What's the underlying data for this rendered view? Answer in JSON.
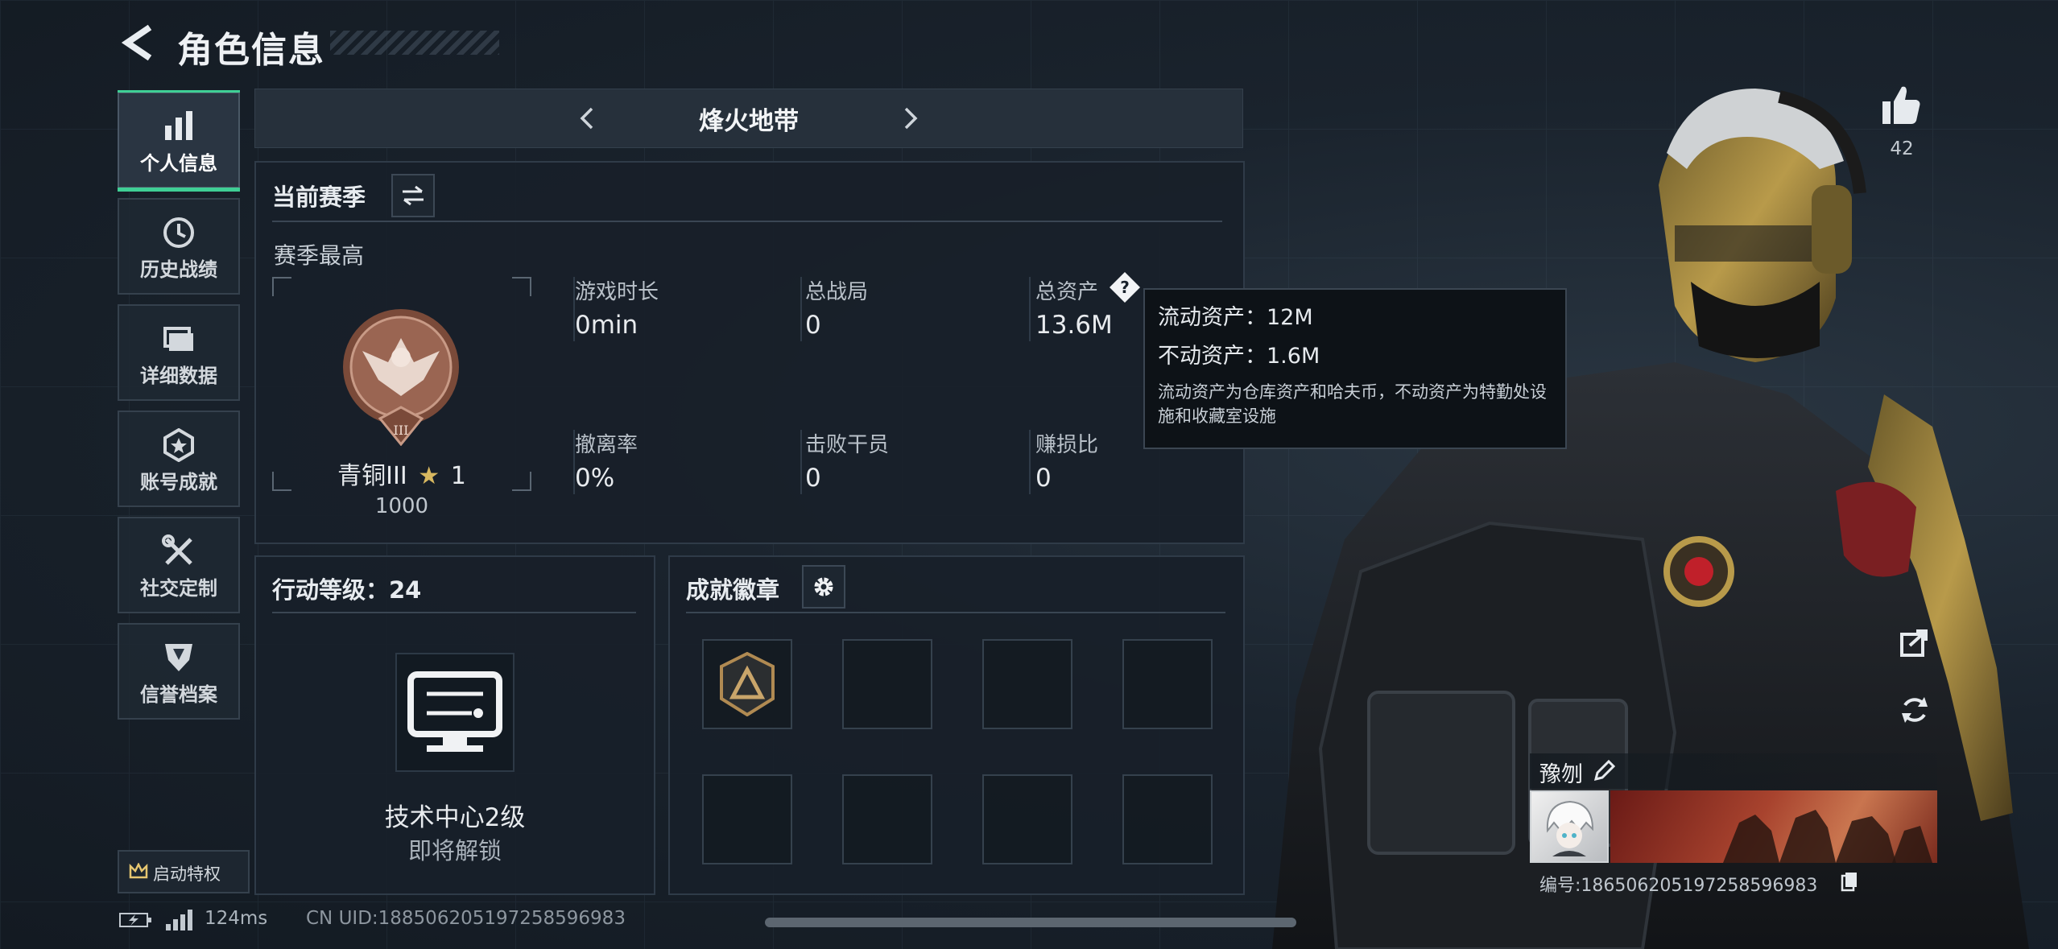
{
  "header": {
    "title": "角色信息"
  },
  "sidebar": {
    "items": [
      {
        "label": "个人信息",
        "icon": "bar-chart-icon",
        "active": true
      },
      {
        "label": "历史战绩",
        "icon": "clock-icon",
        "active": false
      },
      {
        "label": "详细数据",
        "icon": "folder-icon",
        "active": false
      },
      {
        "label": "账号成就",
        "icon": "medal-icon",
        "active": false
      },
      {
        "label": "社交定制",
        "icon": "tools-icon",
        "active": false
      },
      {
        "label": "信誉档案",
        "icon": "shield-icon",
        "active": false
      }
    ],
    "privilege_label": "启动特权"
  },
  "mode_selector": {
    "label": "烽火地带"
  },
  "season": {
    "title": "当前赛季",
    "subtitle": "赛季最高",
    "rank_name": "青铜III",
    "rank_stars": "1",
    "rank_points": "1000",
    "stats": [
      {
        "label": "游戏时长",
        "value": "0min"
      },
      {
        "label": "总战局",
        "value": "0"
      },
      {
        "label": "总资产",
        "value": "13.6M"
      },
      {
        "label": "撤离率",
        "value": "0%"
      },
      {
        "label": "击败干员",
        "value": "0"
      },
      {
        "label": "赚损比",
        "value": "0"
      }
    ]
  },
  "tooltip": {
    "line1": "流动资产：12M",
    "line2": "不动资产：1.6M",
    "desc": "流动资产为仓库资产和哈夫币，不动资产为特勤处设施和收藏室设施"
  },
  "action_level": {
    "title": "行动等级：24",
    "unlock_name": "技术中心2级",
    "unlock_status": "即将解锁"
  },
  "badges": {
    "title": "成就徽章"
  },
  "likes": {
    "count": "42"
  },
  "player": {
    "name": "豫刎",
    "id_text": "编号:1865062051972585969​83"
  },
  "status_bar": {
    "ping": "124ms",
    "uid": "CN UID:1885062051972585969​83"
  },
  "colors": {
    "accent": "#3fcf95",
    "bg": "#17202a",
    "tooltip_bg": "#0d1217"
  }
}
